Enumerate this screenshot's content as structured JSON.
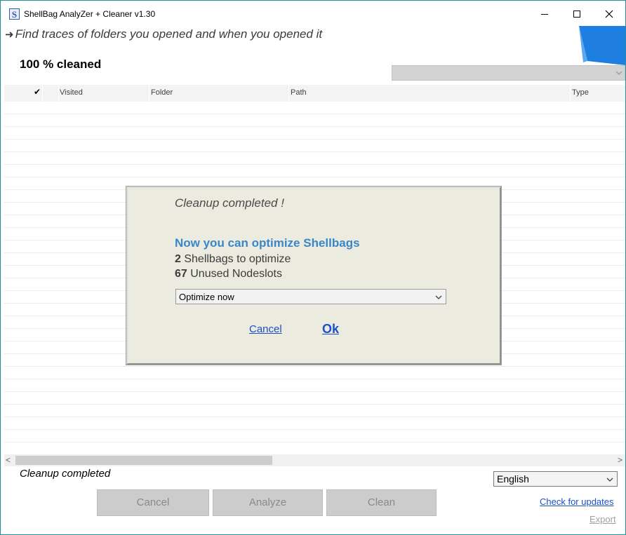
{
  "window": {
    "title": "ShellBag  AnalyZer + Cleaner v1.30",
    "icon": "app-s-logo-icon"
  },
  "header": {
    "arrow": "➜",
    "subtitle": "Find traces of folders you opened and when you opened it",
    "progress_text": "100 % cleaned"
  },
  "table": {
    "columns": {
      "check": "✔",
      "visited": "Visited",
      "folder": "Folder",
      "path": "Path",
      "type": "Type"
    },
    "rows": []
  },
  "status": {
    "text": "Cleanup completed"
  },
  "language": {
    "selected": "English"
  },
  "buttons": {
    "cancel": "Cancel",
    "analyze": "Analyze",
    "clean": "Clean"
  },
  "links": {
    "check_updates": "Check for updates",
    "export": "Export"
  },
  "dialog": {
    "title": "Cleanup completed !",
    "heading": "Now you can optimize Shellbags",
    "shellbags_count": "2",
    "shellbags_label": " Shellbags to optimize",
    "nodeslots_count": "67",
    "nodeslots_label": " Unused Nodeslots",
    "option_selected": "Optimize now",
    "cancel_label": "Cancel",
    "ok_label": "Ok"
  },
  "colors": {
    "window_border": "#1e8ea1",
    "dialog_bg": "#ecebdf",
    "heading_blue": "#3a86c6",
    "link_blue": "#1a50c8",
    "corner_accent": "#1e7fe0"
  }
}
